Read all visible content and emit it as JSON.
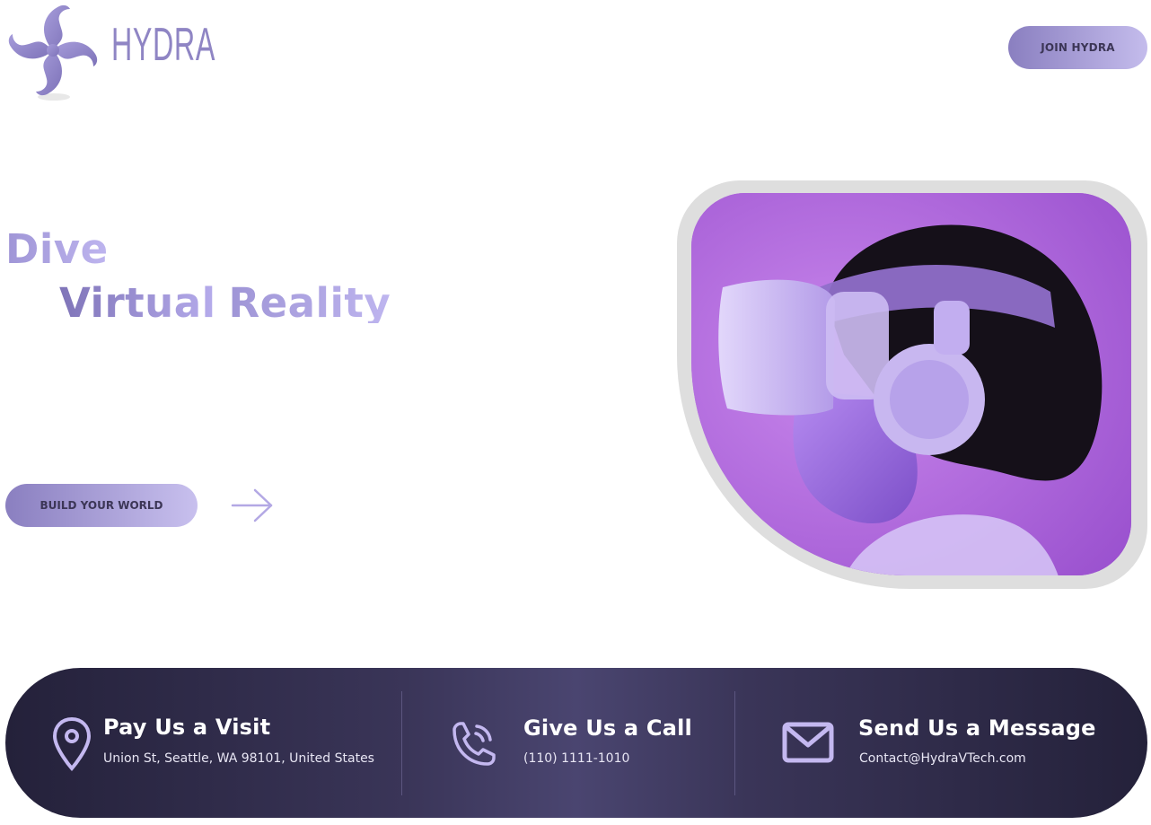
{
  "header": {
    "brand": "HYDRA",
    "join_label": "JOIN HYDRA"
  },
  "hero": {
    "line1": "Dive",
    "line2_word1": "Virtual",
    "line2_word2": "Reality",
    "cta_label": "BUILD YOUR WORLD",
    "image_alt": "Person wearing VR headset on purple background"
  },
  "contact": {
    "visit": {
      "title": "Pay Us a Visit",
      "detail": "Union St, Seattle, WA 98101, United States"
    },
    "call": {
      "title": "Give Us a Call",
      "detail": "(110) 1111-1010"
    },
    "message": {
      "title": "Send Us a Message",
      "detail": "Contact@HydraVTech.com"
    }
  },
  "colors": {
    "accent": "#8f85c4",
    "accent_light": "#c4bcec",
    "dark_bar": "#24213a",
    "image_bg": "#a95fdc"
  }
}
